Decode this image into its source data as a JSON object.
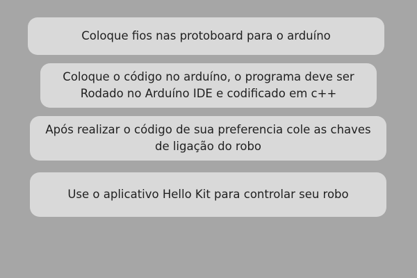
{
  "steps": [
    {
      "lines": [
        "Coloque fios nas protoboard para o arduíno"
      ]
    },
    {
      "lines": [
        "Coloque o código no arduíno, o programa deve ser",
        "Rodado no Arduíno IDE e codificado em c++"
      ]
    },
    {
      "lines": [
        "Após realizar o código de sua preferencia cole as chaves",
        "de ligação do robo"
      ]
    },
    {
      "lines": [
        "Use o aplicativo Hello Kit para controlar seu robo"
      ]
    }
  ],
  "colors": {
    "background": "#a6a6a6",
    "card": "#d9d9d9",
    "text": "#1f1f1f"
  }
}
